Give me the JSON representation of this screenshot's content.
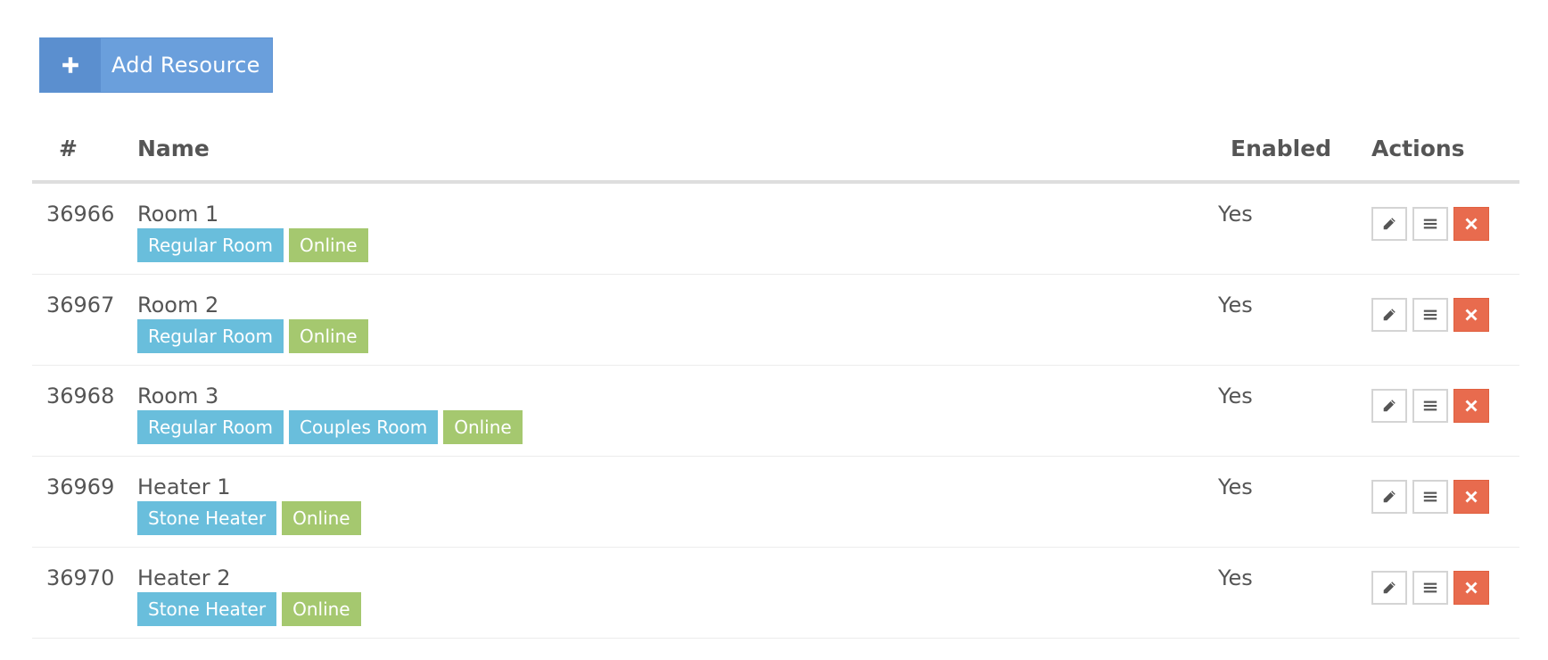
{
  "toolbar": {
    "add_label": "Add Resource"
  },
  "table": {
    "headers": {
      "num": "#",
      "name": "Name",
      "enabled": "Enabled",
      "actions": "Actions"
    },
    "rows": [
      {
        "id": "36966",
        "name": "Room 1",
        "tags": [
          {
            "text": "Regular Room",
            "kind": "type"
          },
          {
            "text": "Online",
            "kind": "status"
          }
        ],
        "enabled": "Yes"
      },
      {
        "id": "36967",
        "name": "Room 2",
        "tags": [
          {
            "text": "Regular Room",
            "kind": "type"
          },
          {
            "text": "Online",
            "kind": "status"
          }
        ],
        "enabled": "Yes"
      },
      {
        "id": "36968",
        "name": "Room 3",
        "tags": [
          {
            "text": "Regular Room",
            "kind": "type"
          },
          {
            "text": "Couples Room",
            "kind": "type"
          },
          {
            "text": "Online",
            "kind": "status"
          }
        ],
        "enabled": "Yes"
      },
      {
        "id": "36969",
        "name": "Heater 1",
        "tags": [
          {
            "text": "Stone Heater",
            "kind": "type"
          },
          {
            "text": "Online",
            "kind": "status"
          }
        ],
        "enabled": "Yes"
      },
      {
        "id": "36970",
        "name": "Heater 2",
        "tags": [
          {
            "text": "Stone Heater",
            "kind": "type"
          },
          {
            "text": "Online",
            "kind": "status"
          }
        ],
        "enabled": "Yes"
      }
    ]
  },
  "icons": {
    "add": "plus-icon",
    "edit": "pencil-icon",
    "list": "list-icon",
    "delete": "close-icon"
  },
  "colors": {
    "primary": "#6a9fdc",
    "primary_dark": "#5b8fcf",
    "tag_type": "#69bedc",
    "tag_status": "#a5c86f",
    "danger": "#e86b4e"
  }
}
